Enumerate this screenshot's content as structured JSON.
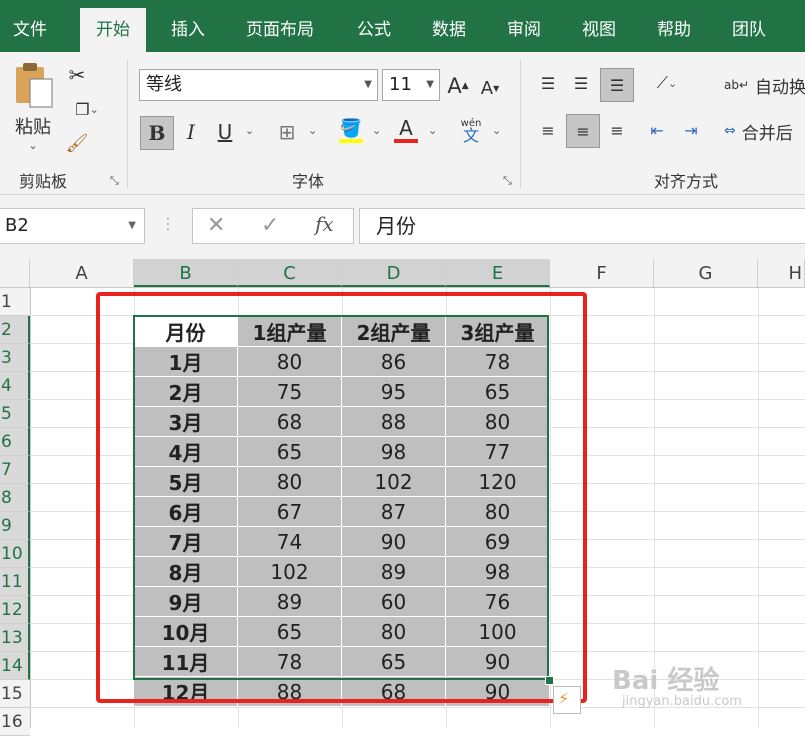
{
  "ribbon_tabs": [
    "文件",
    "开始",
    "插入",
    "页面布局",
    "公式",
    "数据",
    "审阅",
    "视图",
    "帮助",
    "团队"
  ],
  "clipboard": {
    "paste_label": "粘贴",
    "group_label": "剪贴板"
  },
  "font": {
    "name": "等线",
    "size": "11",
    "group_label": "字体",
    "bold": "B",
    "italic": "I",
    "underline": "U",
    "font_color_glyph": "A",
    "phonetic_top": "wén",
    "phonetic_bottom": "文"
  },
  "alignment": {
    "wrap_text": "自动换",
    "merge": "合并后",
    "group_label": "对齐方式"
  },
  "formula_bar": {
    "name_box": "B2",
    "fx": "fx",
    "content": "月份"
  },
  "columns": [
    "A",
    "B",
    "C",
    "D",
    "E",
    "F",
    "G",
    "H"
  ],
  "rows": [
    "1",
    "2",
    "3",
    "4",
    "5",
    "6",
    "7",
    "8",
    "9",
    "10",
    "11",
    "12",
    "13",
    "14",
    "15",
    "16"
  ],
  "table": {
    "header": [
      "月份",
      "1组产量",
      "2组产量",
      "3组产量"
    ],
    "rows": [
      [
        "1月",
        "80",
        "86",
        "78"
      ],
      [
        "2月",
        "75",
        "95",
        "65"
      ],
      [
        "3月",
        "68",
        "88",
        "80"
      ],
      [
        "4月",
        "65",
        "98",
        "77"
      ],
      [
        "5月",
        "80",
        "102",
        "120"
      ],
      [
        "6月",
        "67",
        "87",
        "80"
      ],
      [
        "7月",
        "74",
        "90",
        "69"
      ],
      [
        "8月",
        "102",
        "89",
        "98"
      ],
      [
        "9月",
        "89",
        "60",
        "76"
      ],
      [
        "10月",
        "65",
        "80",
        "100"
      ],
      [
        "11月",
        "78",
        "65",
        "90"
      ],
      [
        "12月",
        "88",
        "68",
        "90"
      ]
    ]
  },
  "watermark": {
    "main": "Bai 经验",
    "sub": "jingyan.baidu.com"
  },
  "colors": {
    "accent": "#217346",
    "highlight_red": "#e8231d",
    "cell_fill": "#bfbfbf"
  }
}
